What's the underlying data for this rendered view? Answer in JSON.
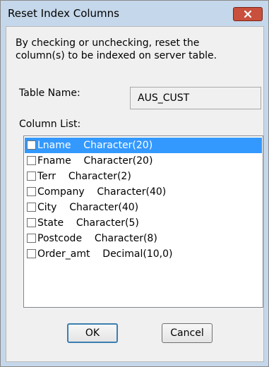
{
  "dialog": {
    "title": "Reset Index Columns",
    "description_line1": "By checking or unchecking,  reset the",
    "description_line2": "column(s) to be indexed on server table."
  },
  "table_name": {
    "label": "Table Name:",
    "value": "AUS_CUST"
  },
  "column_list": {
    "label": "Column List:",
    "items": [
      {
        "text": "Lname    Character(20)",
        "checked": false,
        "selected": true
      },
      {
        "text": "Fname    Character(20)",
        "checked": false,
        "selected": false
      },
      {
        "text": "Terr    Character(2)",
        "checked": false,
        "selected": false
      },
      {
        "text": "Company    Character(40)",
        "checked": false,
        "selected": false
      },
      {
        "text": "City    Character(40)",
        "checked": false,
        "selected": false
      },
      {
        "text": "State    Character(5)",
        "checked": false,
        "selected": false
      },
      {
        "text": "Postcode    Character(8)",
        "checked": false,
        "selected": false
      },
      {
        "text": "Order_amt    Decimal(10,0)",
        "checked": false,
        "selected": false
      }
    ]
  },
  "buttons": {
    "ok_label": "OK",
    "cancel_label": "Cancel"
  },
  "icons": {
    "close": "close-icon"
  },
  "colors": {
    "title_bar": "#c5d7ea",
    "close_button": "#c8503c",
    "selection": "#3399ff",
    "client_bg": "#f0f0f0"
  }
}
